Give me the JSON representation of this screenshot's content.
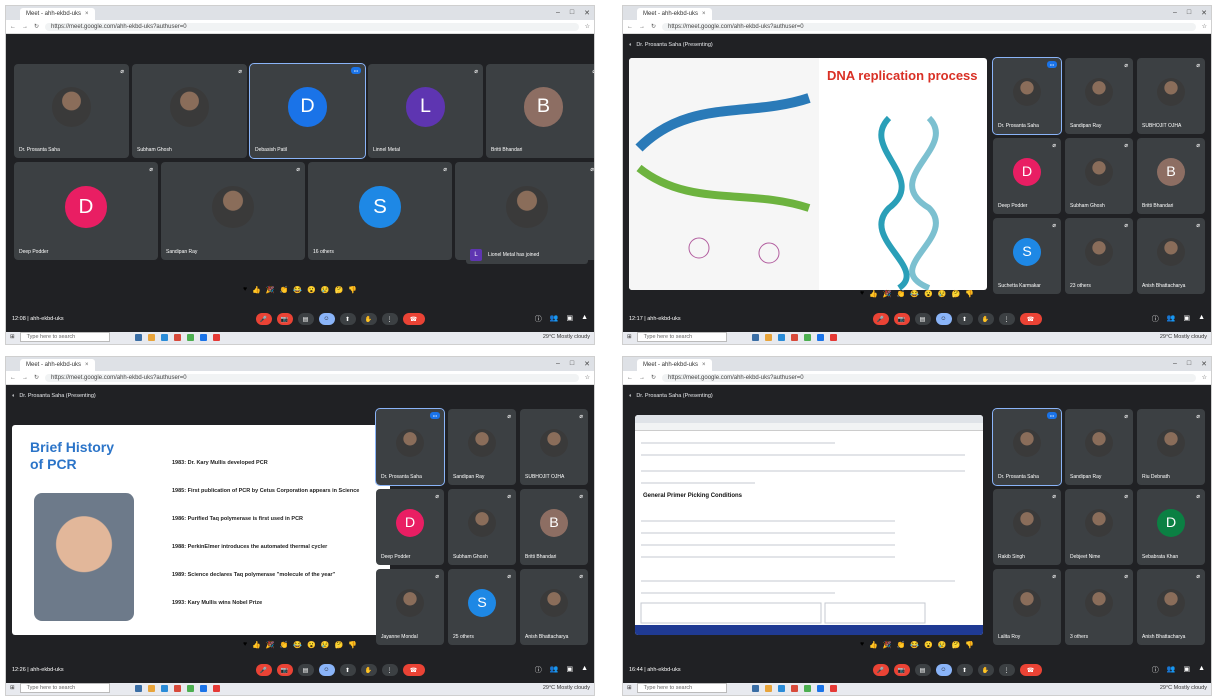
{
  "browser": {
    "tab_title": "Meet - ahh-ekbd-uks",
    "url": "https://meet.google.com/ahh-ekbd-uks?authuser=0"
  },
  "taskbar": {
    "search_placeholder": "Type here to search",
    "weather": "29°C Mostly cloudy"
  },
  "reactions": [
    "♥",
    "👍",
    "🎉",
    "👏",
    "😂",
    "😮",
    "😢",
    "🤔",
    "👎"
  ],
  "q1": {
    "meta": "12:08 | ahh-ekbd-uks",
    "tiles": [
      {
        "name": "Dr. Prosanta Saha",
        "kind": "photo"
      },
      {
        "name": "Subham Ghosh",
        "kind": "photo"
      },
      {
        "name": "Debasish Patil",
        "kind": "initial",
        "initial": "D",
        "color": "#1a73e8",
        "active": true
      },
      {
        "name": "Linnel Metal",
        "kind": "initial",
        "initial": "L",
        "color": "#5e35b1"
      },
      {
        "name": "Britti Bhandari",
        "kind": "initial",
        "initial": "B",
        "color": "#8d6e63"
      },
      {
        "name": "Deep Podder",
        "kind": "initial",
        "initial": "D",
        "color": "#e91e63"
      },
      {
        "name": "Sandipan Ray",
        "kind": "photo"
      },
      {
        "name": "16 others",
        "kind": "initial",
        "initial": "S",
        "color": "#1e88e5"
      },
      {
        "name": "",
        "kind": "photo"
      }
    ],
    "toast": {
      "initial": "L",
      "text": "Lionel Metal has joined"
    }
  },
  "q2": {
    "meta": "12:17 | ahh-ekbd-uks",
    "presenting": "Dr. Prosanta Saha (Presenting)",
    "slide_title": "DNA replication process",
    "tiles": [
      {
        "name": "Dr. Prosanta Saha",
        "kind": "photo",
        "active": true
      },
      {
        "name": "Sandipan Ray",
        "kind": "photo"
      },
      {
        "name": "SUBHOJIT OJHA",
        "kind": "photo"
      },
      {
        "name": "Deep Podder",
        "kind": "initial",
        "initial": "D",
        "color": "#e91e63"
      },
      {
        "name": "Subham Ghosh",
        "kind": "photo"
      },
      {
        "name": "Britti Bhandari",
        "kind": "initial",
        "initial": "B",
        "color": "#8d6e63"
      },
      {
        "name": "Suchetta Karmakar",
        "kind": "initial",
        "initial": "S",
        "color": "#1e88e5"
      },
      {
        "name": "23 others",
        "kind": "photo"
      },
      {
        "name": "Anish Bhattacharya",
        "kind": "photo"
      }
    ]
  },
  "q3": {
    "meta": "12:26 | ahh-ekbd-uks",
    "presenting": "Dr. Prosanta Saha (Presenting)",
    "slide_title_line1": "Brief History",
    "slide_title_line2": "of PCR",
    "history": [
      "1983: Dr. Kary Mullis developed PCR",
      "1985: First publication of PCR by Cetus Corporation appears in Science",
      "1986: Purified Taq polymerase is first used in PCR",
      "1988: PerkinElmer introduces the automated thermal cycler",
      "1989: Science declares Taq polymerase \"molecule of the year\"",
      "1993: Kary Mullis wins Nobel Prize"
    ],
    "tiles": [
      {
        "name": "Dr. Prosanta Saha",
        "kind": "photo",
        "active": true
      },
      {
        "name": "Sandipan Ray",
        "kind": "photo"
      },
      {
        "name": "SUBHOJIT OJHA",
        "kind": "photo"
      },
      {
        "name": "Deep Podder",
        "kind": "initial",
        "initial": "D",
        "color": "#e91e63"
      },
      {
        "name": "Subham Ghosh",
        "kind": "photo"
      },
      {
        "name": "Britti Bhandari",
        "kind": "initial",
        "initial": "B",
        "color": "#8d6e63"
      },
      {
        "name": "Jayanne Mondal",
        "kind": "photo"
      },
      {
        "name": "25 others",
        "kind": "initial",
        "initial": "S",
        "color": "#1e88e5"
      },
      {
        "name": "Anish Bhattacharya",
        "kind": "photo"
      }
    ]
  },
  "q4": {
    "meta": "16:44 | ahh-ekbd-uks",
    "presenting": "Dr. Prosanta Saha (Presenting)",
    "shared_heading": "General Primer Picking Conditions",
    "tiles": [
      {
        "name": "Dr. Prosanta Saha",
        "kind": "photo",
        "active": true
      },
      {
        "name": "Sandipan Ray",
        "kind": "photo"
      },
      {
        "name": "Riu Debnath",
        "kind": "photo"
      },
      {
        "name": "Rakib Singh",
        "kind": "photo"
      },
      {
        "name": "Debjeet Nime",
        "kind": "photo"
      },
      {
        "name": "Sebabrata Khan",
        "kind": "initial",
        "initial": "D",
        "color": "#0b8043"
      },
      {
        "name": "Lalita Roy",
        "kind": "photo"
      },
      {
        "name": "3 others",
        "kind": "photo"
      },
      {
        "name": "Anish Bhattacharya",
        "kind": "photo"
      }
    ]
  }
}
